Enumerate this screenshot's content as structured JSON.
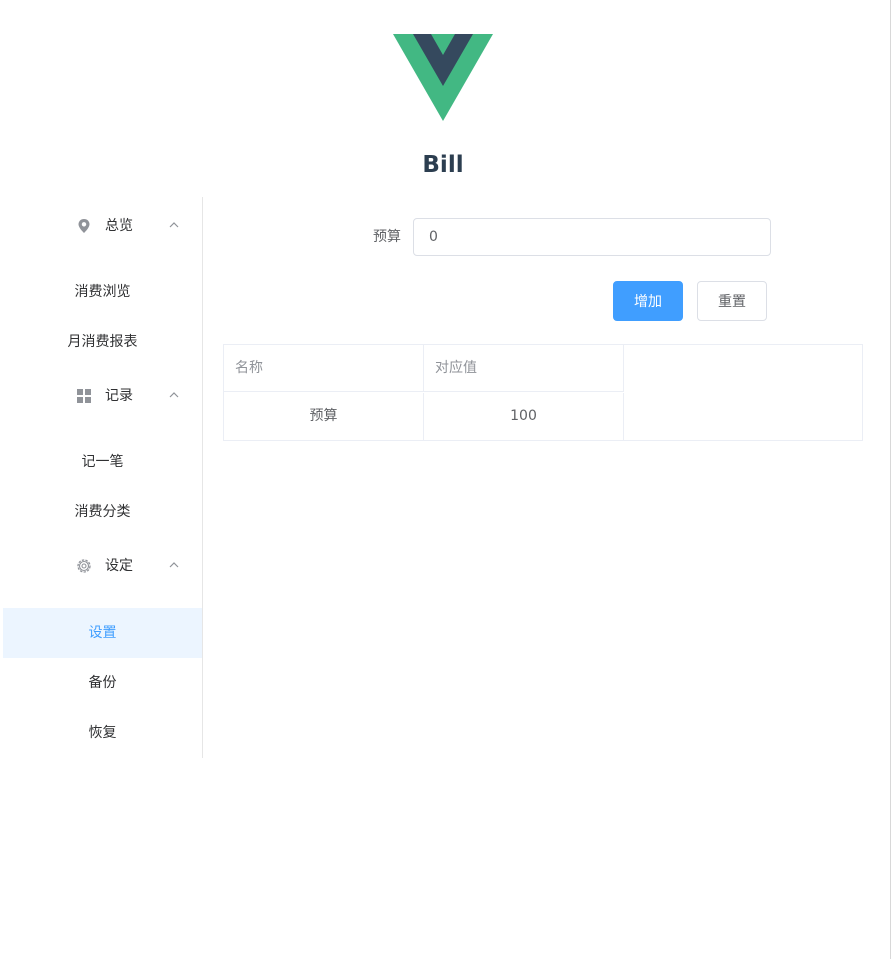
{
  "app": {
    "title": "Bill",
    "logo_colors": {
      "outer": "#42b883",
      "inner": "#35495e"
    }
  },
  "sidebar": {
    "groups": [
      {
        "label": "总览",
        "icon": "location-icon",
        "expanded": true
      },
      {
        "label": "记录",
        "icon": "grid-icon",
        "expanded": true
      },
      {
        "label": "设定",
        "icon": "gear-icon",
        "expanded": true
      }
    ],
    "items": [
      {
        "label": "消费浏览"
      },
      {
        "label": "月消费报表"
      },
      {
        "label": "记一笔"
      },
      {
        "label": "消费分类"
      },
      {
        "label": "设置",
        "active": true
      },
      {
        "label": "备份"
      },
      {
        "label": "恢复"
      }
    ]
  },
  "form": {
    "budget_label": "预算",
    "budget_value": "0",
    "add_label": "增加",
    "reset_label": "重置"
  },
  "table": {
    "headers": [
      "名称",
      "对应值"
    ],
    "rows": [
      [
        "预算",
        "100"
      ]
    ]
  },
  "colors": {
    "accent": "#409eff",
    "active_bg": "#ecf5ff"
  }
}
